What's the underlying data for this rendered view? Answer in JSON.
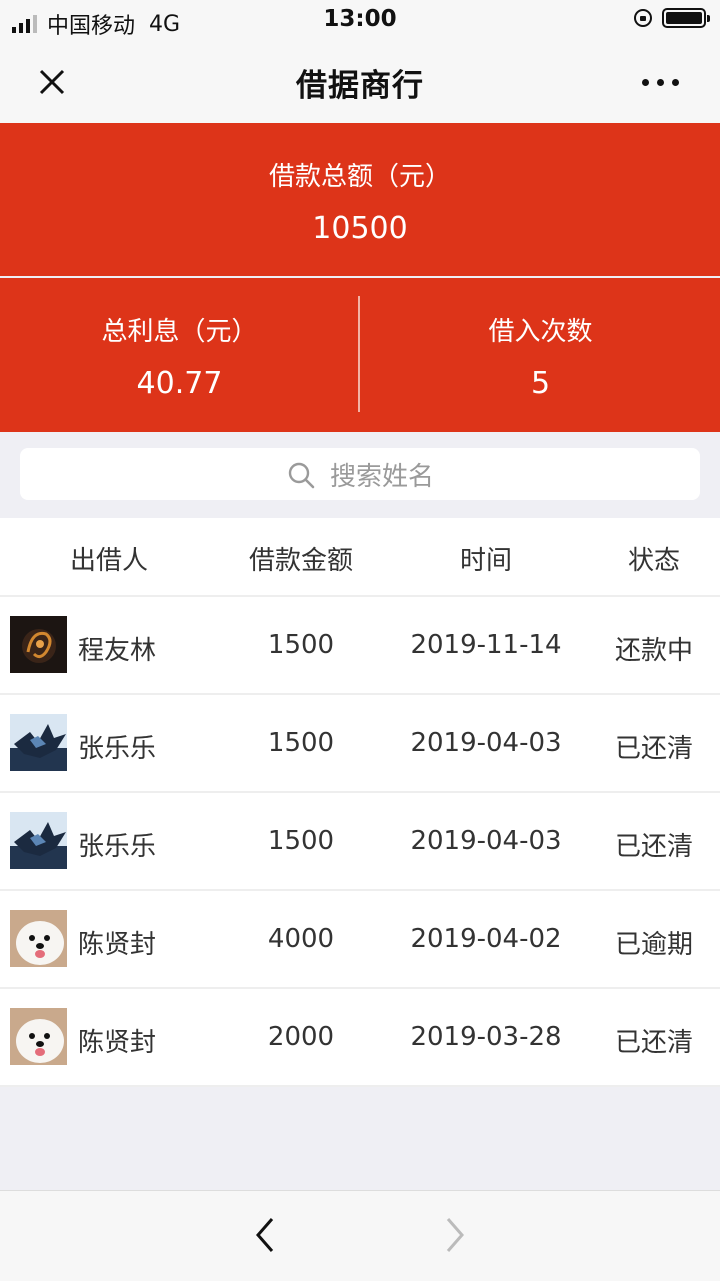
{
  "status_bar": {
    "carrier": "中国移动",
    "network": "4G",
    "time": "13:00"
  },
  "nav": {
    "title": "借据商行"
  },
  "summary": {
    "total_label": "借款总额（元）",
    "total_value": "10500",
    "interest_label": "总利息（元）",
    "interest_value": "40.77",
    "count_label": "借入次数",
    "count_value": "5"
  },
  "search": {
    "placeholder": "搜索姓名"
  },
  "table": {
    "headers": {
      "lender": "出借人",
      "amount": "借款金额",
      "time": "时间",
      "status": "状态"
    },
    "rows": [
      {
        "name": "程友林",
        "amount": "1500",
        "date": "2019-11-14",
        "status": "还款中",
        "avatar": "dark-dragon-avatar"
      },
      {
        "name": "张乐乐",
        "amount": "1500",
        "date": "2019-04-03",
        "status": "已还清",
        "avatar": "blue-bird-avatar"
      },
      {
        "name": "张乐乐",
        "amount": "1500",
        "date": "2019-04-03",
        "status": "已还清",
        "avatar": "blue-bird-avatar"
      },
      {
        "name": "陈贤封",
        "amount": "4000",
        "date": "2019-04-02",
        "status": "已逾期",
        "avatar": "white-dog-avatar"
      },
      {
        "name": "陈贤封",
        "amount": "2000",
        "date": "2019-03-28",
        "status": "已还清",
        "avatar": "white-dog-avatar"
      }
    ]
  },
  "colors": {
    "accent": "#dd3419",
    "background": "#efeff4"
  }
}
